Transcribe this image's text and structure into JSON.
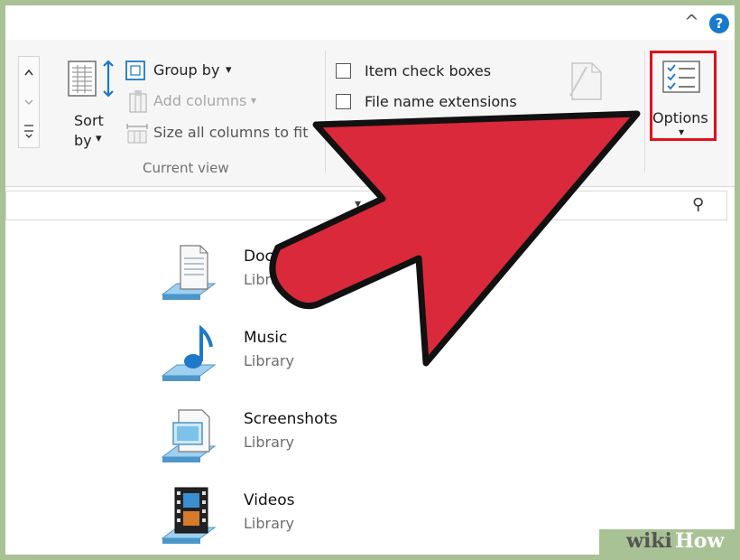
{
  "window": {
    "collapse_glyph": "^",
    "help_glyph": "?"
  },
  "ribbon": {
    "sort_by": {
      "line1": "Sort",
      "line2": "by",
      "arrow": "▾"
    },
    "group_by": "Group by",
    "add_columns": "Add columns",
    "size_columns": "Size all columns to fit",
    "group_label": "Current view",
    "item_check_boxes": "Item check boxes",
    "file_name_extensions": "File name extensions",
    "hide_selected": "Hide selected",
    "options": "Options",
    "dropdown_arrow": "▾"
  },
  "address": {
    "search_glyph": "⚲"
  },
  "items": [
    {
      "name": "Documents",
      "sub": "Library"
    },
    {
      "name": "Music",
      "sub": "Library"
    },
    {
      "name": "Screenshots",
      "sub": "Library"
    },
    {
      "name": "Videos",
      "sub": "Library"
    }
  ],
  "watermark": {
    "part1": "wiki",
    "part2": "How"
  },
  "colors": {
    "arrow": "#d9293a",
    "highlight": "#e0101d",
    "accent": "#1979ca"
  }
}
